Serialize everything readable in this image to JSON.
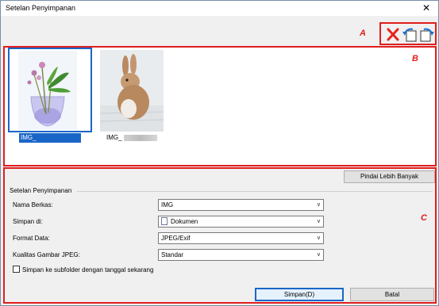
{
  "window": {
    "title": "Setelan Penyimpanan",
    "close_glyph": "✕"
  },
  "annotations": {
    "a": "A",
    "b": "B",
    "c": "C"
  },
  "toolbar": {
    "icons": [
      "delete-icon",
      "rotate-left-icon",
      "rotate-right-icon"
    ]
  },
  "thumbnails": [
    {
      "caption": "IMG_",
      "selected": true
    },
    {
      "caption": "IMG_",
      "selected": false
    }
  ],
  "scan_more_label": "Pindai Lebih Banyak",
  "settings": {
    "group_title": "Setelan Penyimpanan",
    "file_name": {
      "label": "Nama Berkas:",
      "value": "IMG"
    },
    "save_in": {
      "label": "Simpan di:",
      "value": "Dokumen"
    },
    "data_format": {
      "label": "Format Data:",
      "value": "JPEG/Exif"
    },
    "jpeg_quality": {
      "label": "Kualitas Gambar JPEG:",
      "value": "Standar"
    },
    "subfolder_label": "Simpan ke subfolder dengan tanggal sekarang"
  },
  "buttons": {
    "save": "Simpan(D)",
    "cancel": "Batal"
  },
  "colors": {
    "annotation": "#e01e1e",
    "selection": "#1a66c8"
  }
}
